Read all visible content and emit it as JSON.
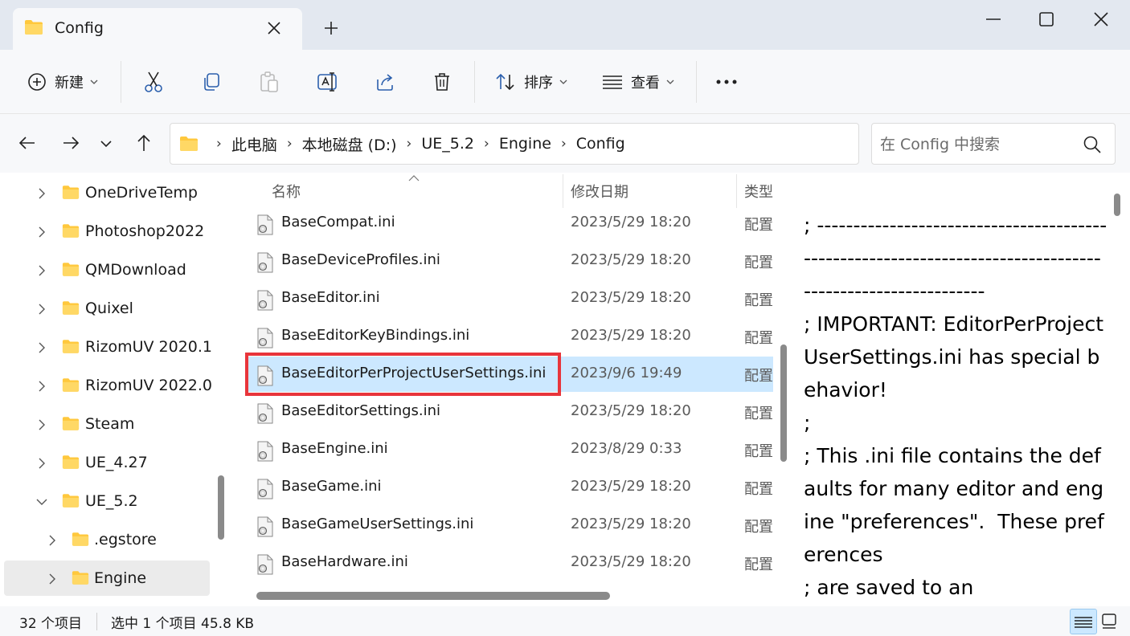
{
  "tab": {
    "title": "Config"
  },
  "window": {
    "minimize_label": "minimize",
    "maximize_label": "maximize",
    "close_label": "close"
  },
  "toolbar": {
    "new_label": "新建",
    "sort_label": "排序",
    "view_label": "查看",
    "more_label": "•••"
  },
  "breadcrumbs": [
    "此电脑",
    "本地磁盘 (D:)",
    "UE_5.2",
    "Engine",
    "Config"
  ],
  "search": {
    "placeholder": "在 Config 中搜索"
  },
  "nav_tree": [
    {
      "label": "OneDriveTemp",
      "expanded": false
    },
    {
      "label": "Photoshop2022",
      "expanded": false
    },
    {
      "label": "QMDownload",
      "expanded": false
    },
    {
      "label": "Quixel",
      "expanded": false
    },
    {
      "label": "RizomUV 2020.1",
      "expanded": false
    },
    {
      "label": "RizomUV 2022.0",
      "expanded": false
    },
    {
      "label": "Steam",
      "expanded": false
    },
    {
      "label": "UE_4.27",
      "expanded": false
    },
    {
      "label": "UE_5.2",
      "expanded": true
    },
    {
      "label": ".egstore",
      "expanded": false
    },
    {
      "label": "Engine",
      "expanded": false,
      "selected": true
    }
  ],
  "columns": {
    "name": "名称",
    "date": "修改日期",
    "type": "类型"
  },
  "files": [
    {
      "name": "BaseCompat.ini",
      "date": "2023/5/29 18:20",
      "type": "配置"
    },
    {
      "name": "BaseDeviceProfiles.ini",
      "date": "2023/5/29 18:20",
      "type": "配置"
    },
    {
      "name": "BaseEditor.ini",
      "date": "2023/5/29 18:20",
      "type": "配置"
    },
    {
      "name": "BaseEditorKeyBindings.ini",
      "date": "2023/5/29 18:20",
      "type": "配置"
    },
    {
      "name": "BaseEditorPerProjectUserSettings.ini",
      "date": "2023/9/6 19:49",
      "type": "配置",
      "selected": true
    },
    {
      "name": "BaseEditorSettings.ini",
      "date": "2023/5/29 18:20",
      "type": "配置"
    },
    {
      "name": "BaseEngine.ini",
      "date": "2023/8/29 0:33",
      "type": "配置"
    },
    {
      "name": "BaseGame.ini",
      "date": "2023/5/29 18:20",
      "type": "配置"
    },
    {
      "name": "BaseGameUserSettings.ini",
      "date": "2023/5/29 18:20",
      "type": "配置"
    },
    {
      "name": "BaseHardware.ini",
      "date": "2023/5/29 18:20",
      "type": "配置"
    }
  ],
  "preview": {
    "text": "; ----------------------------------------------------------------------------------------------------------\n; IMPORTANT: EditorPerProjectUserSettings.ini has special behavior!\n;\n; This .ini file contains the defaults for many editor and engine \"preferences\".  These preferences\n; are saved to an"
  },
  "status": {
    "item_count": "32 个项目",
    "selection": "选中 1 个项目  45.8 KB"
  },
  "colors": {
    "accent": "#0067c0",
    "selection": "#cce8ff",
    "highlight_box": "#e8353b",
    "folder": "#ffc83d"
  }
}
